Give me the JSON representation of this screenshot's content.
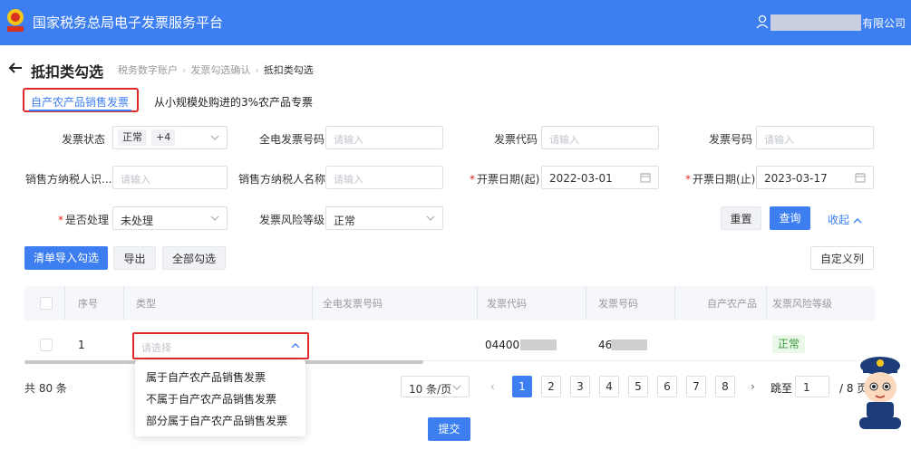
{
  "header": {
    "app_title": "国家税务总局电子发票服务平台",
    "company_suffix": "有限公司"
  },
  "page": {
    "title": "抵扣类勾选",
    "breadcrumb": [
      "税务数字账户",
      "发票勾选确认",
      "抵扣类勾选"
    ]
  },
  "tabs": [
    {
      "label": "自产农产品销售发票",
      "active": true
    },
    {
      "label": "从小规模处购进的3%农产品专票",
      "active": false
    }
  ],
  "filters": {
    "invoice_status": {
      "label": "发票状态",
      "tag": "正常",
      "extra": "+4"
    },
    "full_invoice_no": {
      "label": "全电发票号码",
      "placeholder": "请输入"
    },
    "invoice_code": {
      "label": "发票代码",
      "placeholder": "请输入"
    },
    "invoice_no": {
      "label": "发票号码",
      "placeholder": "请输入"
    },
    "seller_tax_id": {
      "label": "销售方纳税人识...",
      "placeholder": "请输入"
    },
    "seller_name": {
      "label": "销售方纳税人名称",
      "placeholder": "请输入"
    },
    "date_start": {
      "label": "开票日期(起)",
      "required": "*",
      "value": "2022-03-01"
    },
    "date_end": {
      "label": "开票日期(止)",
      "required": "*",
      "value": "2023-03-17"
    },
    "processed": {
      "label": "是否处理",
      "required": "*",
      "value": "未处理"
    },
    "risk_level": {
      "label": "发票风险等级",
      "value": "正常"
    }
  },
  "actions": {
    "reset": "重置",
    "query": "查询",
    "collapse": "收起",
    "import_select": "清单导入勾选",
    "export": "导出",
    "select_all": "全部勾选",
    "custom_columns": "自定义列",
    "submit": "提交"
  },
  "table": {
    "headers": {
      "seq": "序号",
      "type": "类型",
      "full_no": "全电发票号码",
      "code": "发票代码",
      "number": "发票号码",
      "self_product": "自产农产品",
      "risk": "发票风险等级"
    },
    "rows": [
      {
        "seq": "1",
        "type_placeholder": "请选择",
        "code_prefix": "04400",
        "number_prefix": "46",
        "risk": "正常"
      }
    ]
  },
  "type_dropdown": {
    "options": [
      "属于自产农产品销售发票",
      "不属于自产农产品销售发票",
      "部分属于自产农产品销售发票"
    ]
  },
  "pagination": {
    "total": "共 80 条",
    "page_size": "10 条/页",
    "pages": [
      "1",
      "2",
      "3",
      "4",
      "5",
      "6",
      "7",
      "8"
    ],
    "current": "1",
    "jump_label": "跳至",
    "jump_value": "1",
    "page_total": "/ 8 页"
  },
  "colors": {
    "primary": "#3d7ff0",
    "highlight_red": "#e02a2a",
    "status_green": "#3a9a3a"
  }
}
